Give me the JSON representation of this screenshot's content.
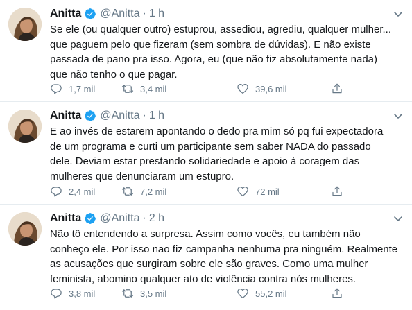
{
  "tweets": [
    {
      "name": "Anitta",
      "handle": "@Anitta",
      "separator": "·",
      "time": "1 h",
      "lines": [
        "Se ele (ou qualquer outro) estuprou, assediou, agrediu, qualquer mulher...",
        "que paguem pelo que fizeram (sem sombra de dúvidas). E não existe",
        "passada de pano pra isso. Agora, eu (que não fiz absolutamente nada)",
        "que não tenho o que pagar."
      ],
      "replies": "1,7 mil",
      "retweets": "3,4 mil",
      "likes": "39,6 mil"
    },
    {
      "name": "Anitta",
      "handle": "@Anitta",
      "separator": "·",
      "time": "1 h",
      "lines": [
        "E ao invés de estarem apontando o dedo pra mim só pq fui expectadora",
        "de um programa e curti um participante sem saber NADA do passado",
        "dele. Deviam estar prestando solidariedade e apoio à coragem das",
        "mulheres que denunciaram um estupro."
      ],
      "replies": "2,4 mil",
      "retweets": "7,2 mil",
      "likes": "72 mil"
    },
    {
      "name": "Anitta",
      "handle": "@Anitta",
      "separator": "·",
      "time": "2 h",
      "lines": [
        "Não tô entendendo a surpresa. Assim como vocês, eu também não",
        "conheço ele. Por isso nao fiz campanha nenhuma pra ninguém. Realmente",
        "as acusações que surgiram sobre ele são graves. Como uma mulher",
        "feminista, abomino qualquer ato de violência contra nós mulheres."
      ],
      "replies": "3,8 mil",
      "retweets": "3,5 mil",
      "likes": "55,2 mil"
    }
  ],
  "colors": {
    "text": "#14171a",
    "secondary": "#657786",
    "verified": "#1da1f2",
    "divider": "#e6ecf0"
  },
  "icons": [
    "verified-badge-icon",
    "caret-down-icon",
    "reply-icon",
    "retweet-icon",
    "like-icon",
    "share-icon"
  ]
}
